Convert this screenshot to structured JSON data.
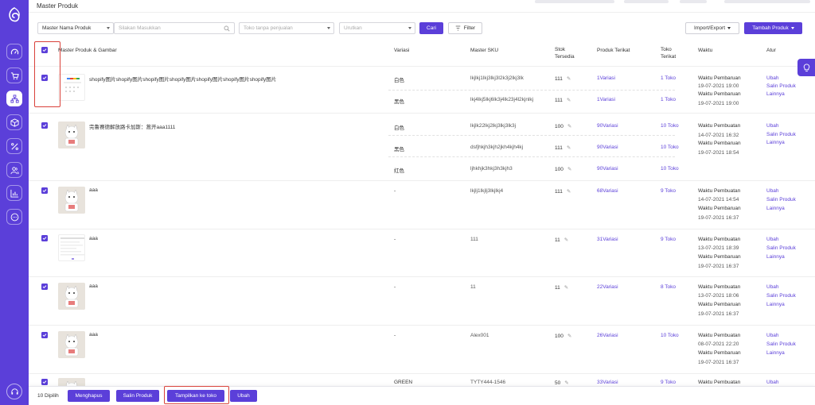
{
  "page_title": "Master Produk",
  "colors": {
    "primary": "#5b3fd9",
    "highlight": "#d9413a"
  },
  "sidebar": {
    "items": [
      {
        "icon": "dashboard-gauge-icon"
      },
      {
        "icon": "cart-icon"
      },
      {
        "icon": "product-tree-icon",
        "active": true
      },
      {
        "icon": "box-icon"
      },
      {
        "icon": "percent-icon"
      },
      {
        "icon": "users-icon"
      },
      {
        "icon": "bar-chart-icon"
      },
      {
        "icon": "chat-icon"
      }
    ],
    "support_icon": "headset-icon"
  },
  "toolbar": {
    "search_type": "Master Nama Produk",
    "search_placeholder": "Silakan Masukkan",
    "store_placeholder": "Toko tanpa penjualan",
    "sort_placeholder": "Urutkan",
    "search_button": "Cari",
    "filter_button": "Filter",
    "import_export": "Import/Export",
    "add_product": "Tambah Produk"
  },
  "headers": {
    "product": "Master Produk & Gambar",
    "variant": "Variasi",
    "sku": "Master SKU",
    "stock_1": "Stok",
    "stock_2": "Tersedia",
    "linked": "Produk Terikat",
    "store_1": "Toko",
    "store_2": "Terikat",
    "time": "Waktu",
    "actions": "Atur"
  },
  "labels": {
    "created": "Waktu Pembuatan",
    "updated": "Waktu Pembaruan",
    "edit": "Ubah",
    "copy": "Salin Produk",
    "more": "Lainnya"
  },
  "rows": [
    {
      "name": "shopify图片shopify图片shopify图片shopify图片shopify图片shopify图片shopify图片",
      "thumb": "google-screenshot",
      "subs": [
        {
          "variant": "白色",
          "sku": "lkjlkj1lkj3lkj3l2k3j2lkj3lk",
          "stock": "111",
          "linked": "1Variasi",
          "store": "1 Toko"
        },
        {
          "variant": "黑色",
          "sku": "lkj4lkj5lkj6lk3j4lk23j4l2kjnlkj",
          "stock": "111",
          "linked": "1Variasi",
          "store": "1 Toko"
        }
      ],
      "created": "",
      "updated": "19-07-2021 19:00",
      "created_b": "19-07-2021 19:00"
    },
    {
      "name": "完鲁赛德解放路卡加斯：蒿开aaa1111",
      "thumb": "cat",
      "subs": [
        {
          "variant": "白色",
          "sku": "lkjlk22lkj2lkj3lkj3lk3j",
          "stock": "100",
          "linked": "90Variasi",
          "store": "10 Toko"
        },
        {
          "variant": "黑色",
          "sku": "dsfjhkjh3kjh2jkh4kjh4kj",
          "stock": "111",
          "linked": "90Variasi",
          "store": "10 Toko"
        },
        {
          "variant": "红色",
          "sku": "ljhkhjk3hkj3h3kjh3",
          "stock": "100",
          "linked": "90Variasi",
          "store": "10 Toko"
        }
      ],
      "created": "14-07-2021 16:32",
      "updated": "19-07-2021 18:54"
    },
    {
      "name": "aaa",
      "thumb": "cat",
      "subs": [
        {
          "variant": "-",
          "sku": "lkjlj1lkjlj3lkjlkj4",
          "stock": "111",
          "linked": "68Variasi",
          "store": "9 Toko"
        }
      ],
      "created": "14-07-2021 14:54",
      "updated": "19-07-2021 16:37"
    },
    {
      "name": "aaa",
      "thumb": "screenshot",
      "subs": [
        {
          "variant": "-",
          "sku": "111",
          "stock": "11",
          "linked": "31Variasi",
          "store": "9 Toko"
        }
      ],
      "created": "13-07-2021 18:39",
      "updated": "19-07-2021 16:37"
    },
    {
      "name": "aaa",
      "thumb": "cat",
      "subs": [
        {
          "variant": "-",
          "sku": "11",
          "stock": "11",
          "linked": "22Variasi",
          "store": "8 Toko"
        }
      ],
      "created": "13-07-2021 18:06",
      "updated": "19-07-2021 16:37"
    },
    {
      "name": "aaa",
      "thumb": "cat",
      "subs": [
        {
          "variant": "-",
          "sku": "Alex001",
          "stock": "100",
          "linked": "26Variasi",
          "store": "10 Toko"
        }
      ],
      "created": "08-07-2021 22:20",
      "updated": "19-07-2021 16:37"
    },
    {
      "name": "",
      "thumb": "cat",
      "subs": [
        {
          "variant": "GREEN",
          "sku": "TYTY444-1546",
          "stock": "50",
          "linked": "33Variasi",
          "store": "9 Toko"
        }
      ],
      "created": "",
      "updated": ""
    }
  ],
  "bottom": {
    "selected_count": "10 Dipilih",
    "delete": "Menghapus",
    "copy": "Salin Produk",
    "show_in_store": "Tampilkan ke toko",
    "edit": "Ubah"
  }
}
